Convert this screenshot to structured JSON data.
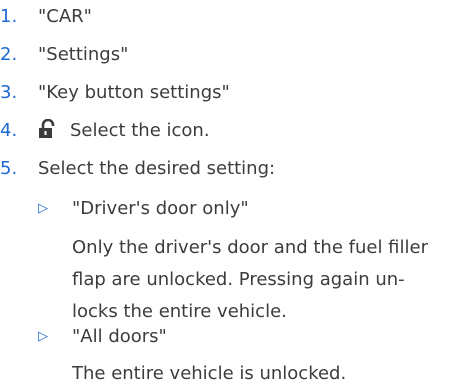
{
  "steps": [
    {
      "number": "1.",
      "text": "\"CAR\""
    },
    {
      "number": "2.",
      "text": "\"Settings\""
    },
    {
      "number": "3.",
      "text": "\"Key button settings\""
    },
    {
      "number": "4.",
      "text": "Select the icon.",
      "icon": "unlock-icon"
    },
    {
      "number": "5.",
      "text": "Select the desired setting:"
    }
  ],
  "options": [
    {
      "bullet": "▷",
      "label": "\"Driver's door only\"",
      "description_lines": [
        "Only the driver's door and the fuel filler",
        "flap are unlocked. Pressing again un-",
        "locks the entire vehicle."
      ]
    },
    {
      "bullet": "▷",
      "label": "\"All doors\"",
      "description_lines": [
        "The entire vehicle is unlocked."
      ]
    }
  ],
  "colors": {
    "accent": "#1c69d4",
    "text": "#3c3c3c"
  }
}
